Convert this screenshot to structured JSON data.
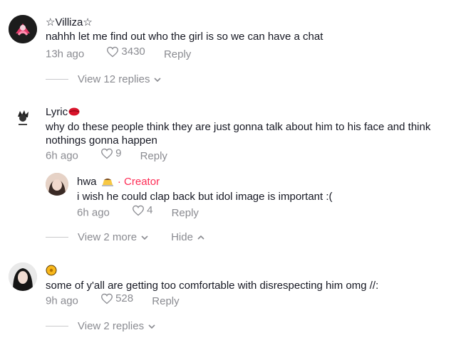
{
  "comments": [
    {
      "username": "☆Villiza☆",
      "text": "nahhh let me find out who the girl is so we can have a chat",
      "time": "13h ago",
      "likes": "3430",
      "reply_label": "Reply",
      "view_replies": "View 12 replies"
    },
    {
      "username": "Lyric",
      "text": "why do these people think they are just gonna talk about him to his face and think nothings gonna happen",
      "time": "6h ago",
      "likes": "9",
      "reply_label": "Reply",
      "reply": {
        "username": "hwa",
        "badge_sep": "·",
        "badge": "Creator",
        "text": "i wish he could clap back but idol image is important :(",
        "time": "6h ago",
        "likes": "4",
        "reply_label": "Reply"
      },
      "view_more": "View 2 more",
      "hide": "Hide"
    },
    {
      "username": "",
      "text": "some of y'all are getting too comfortable with disrespecting him omg //:",
      "time": "9h ago",
      "likes": "528",
      "reply_label": "Reply",
      "view_replies": "View 2 replies"
    }
  ],
  "icons": {
    "like": "heart-outline-icon",
    "expand": "chevron-down-icon",
    "collapse": "chevron-up-icon"
  },
  "colors": {
    "text": "#161823",
    "muted": "#8a8b91",
    "creator": "#fe2c55"
  }
}
